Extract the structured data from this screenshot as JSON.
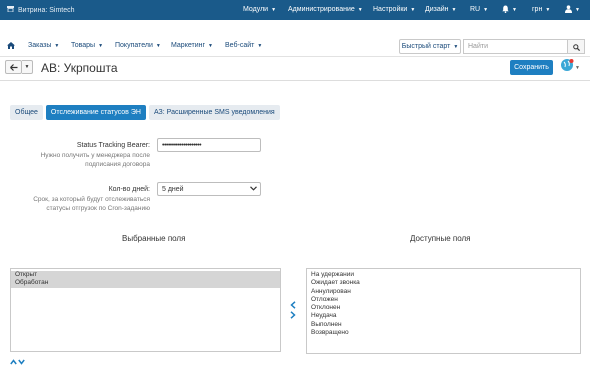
{
  "topbar": {
    "store_label": "Витрина: Simtech",
    "menus": [
      "Модули",
      "Администрирование",
      "Настройки",
      "Дизайн",
      "RU",
      "грн"
    ]
  },
  "nav": {
    "items": [
      "Заказы",
      "Товары",
      "Покупатели",
      "Маркетинг",
      "Веб-сайт"
    ],
    "quick_start": "Быстрый старт",
    "search_placeholder": "Найти"
  },
  "page": {
    "title": "AB: Укрпошта",
    "save_label": "Сохранить"
  },
  "tabs": [
    "Общее",
    "Отслеживание статусов ЭН",
    "АЗ: Расширенные SMS уведомления"
  ],
  "form": {
    "bearer_label": "Status Tracking Bearer:",
    "bearer_help": [
      "Нужно получить у менеджера после",
      "подписания договора"
    ],
    "bearer_value": "••••••••••••••••••••",
    "days_label": "Кол-во дней:",
    "days_help": [
      "Срок, за который будут отслеживаться",
      "статусы отгрузок по Cron-заданию"
    ],
    "days_value": "5 дней"
  },
  "selected": {
    "heading": "Выбранные поля",
    "items": [
      "Открыт",
      "Обработан"
    ]
  },
  "available": {
    "heading": "Доступные поля",
    "items": [
      "На удержании",
      "Ожидает звонка",
      "Аннулирован",
      "Отложен",
      "Отклонен",
      "Неудача",
      "Выполнен",
      "Возвращено"
    ]
  },
  "icons": {
    "store": "store-icon",
    "home": "home-icon",
    "bell": "bell-icon",
    "user": "user-icon",
    "search": "search-icon",
    "back": "arrow-left-icon",
    "globe": "globe-icon"
  },
  "colors": {
    "topbar": "#1a5a8a",
    "accent": "#1e7fc1"
  }
}
